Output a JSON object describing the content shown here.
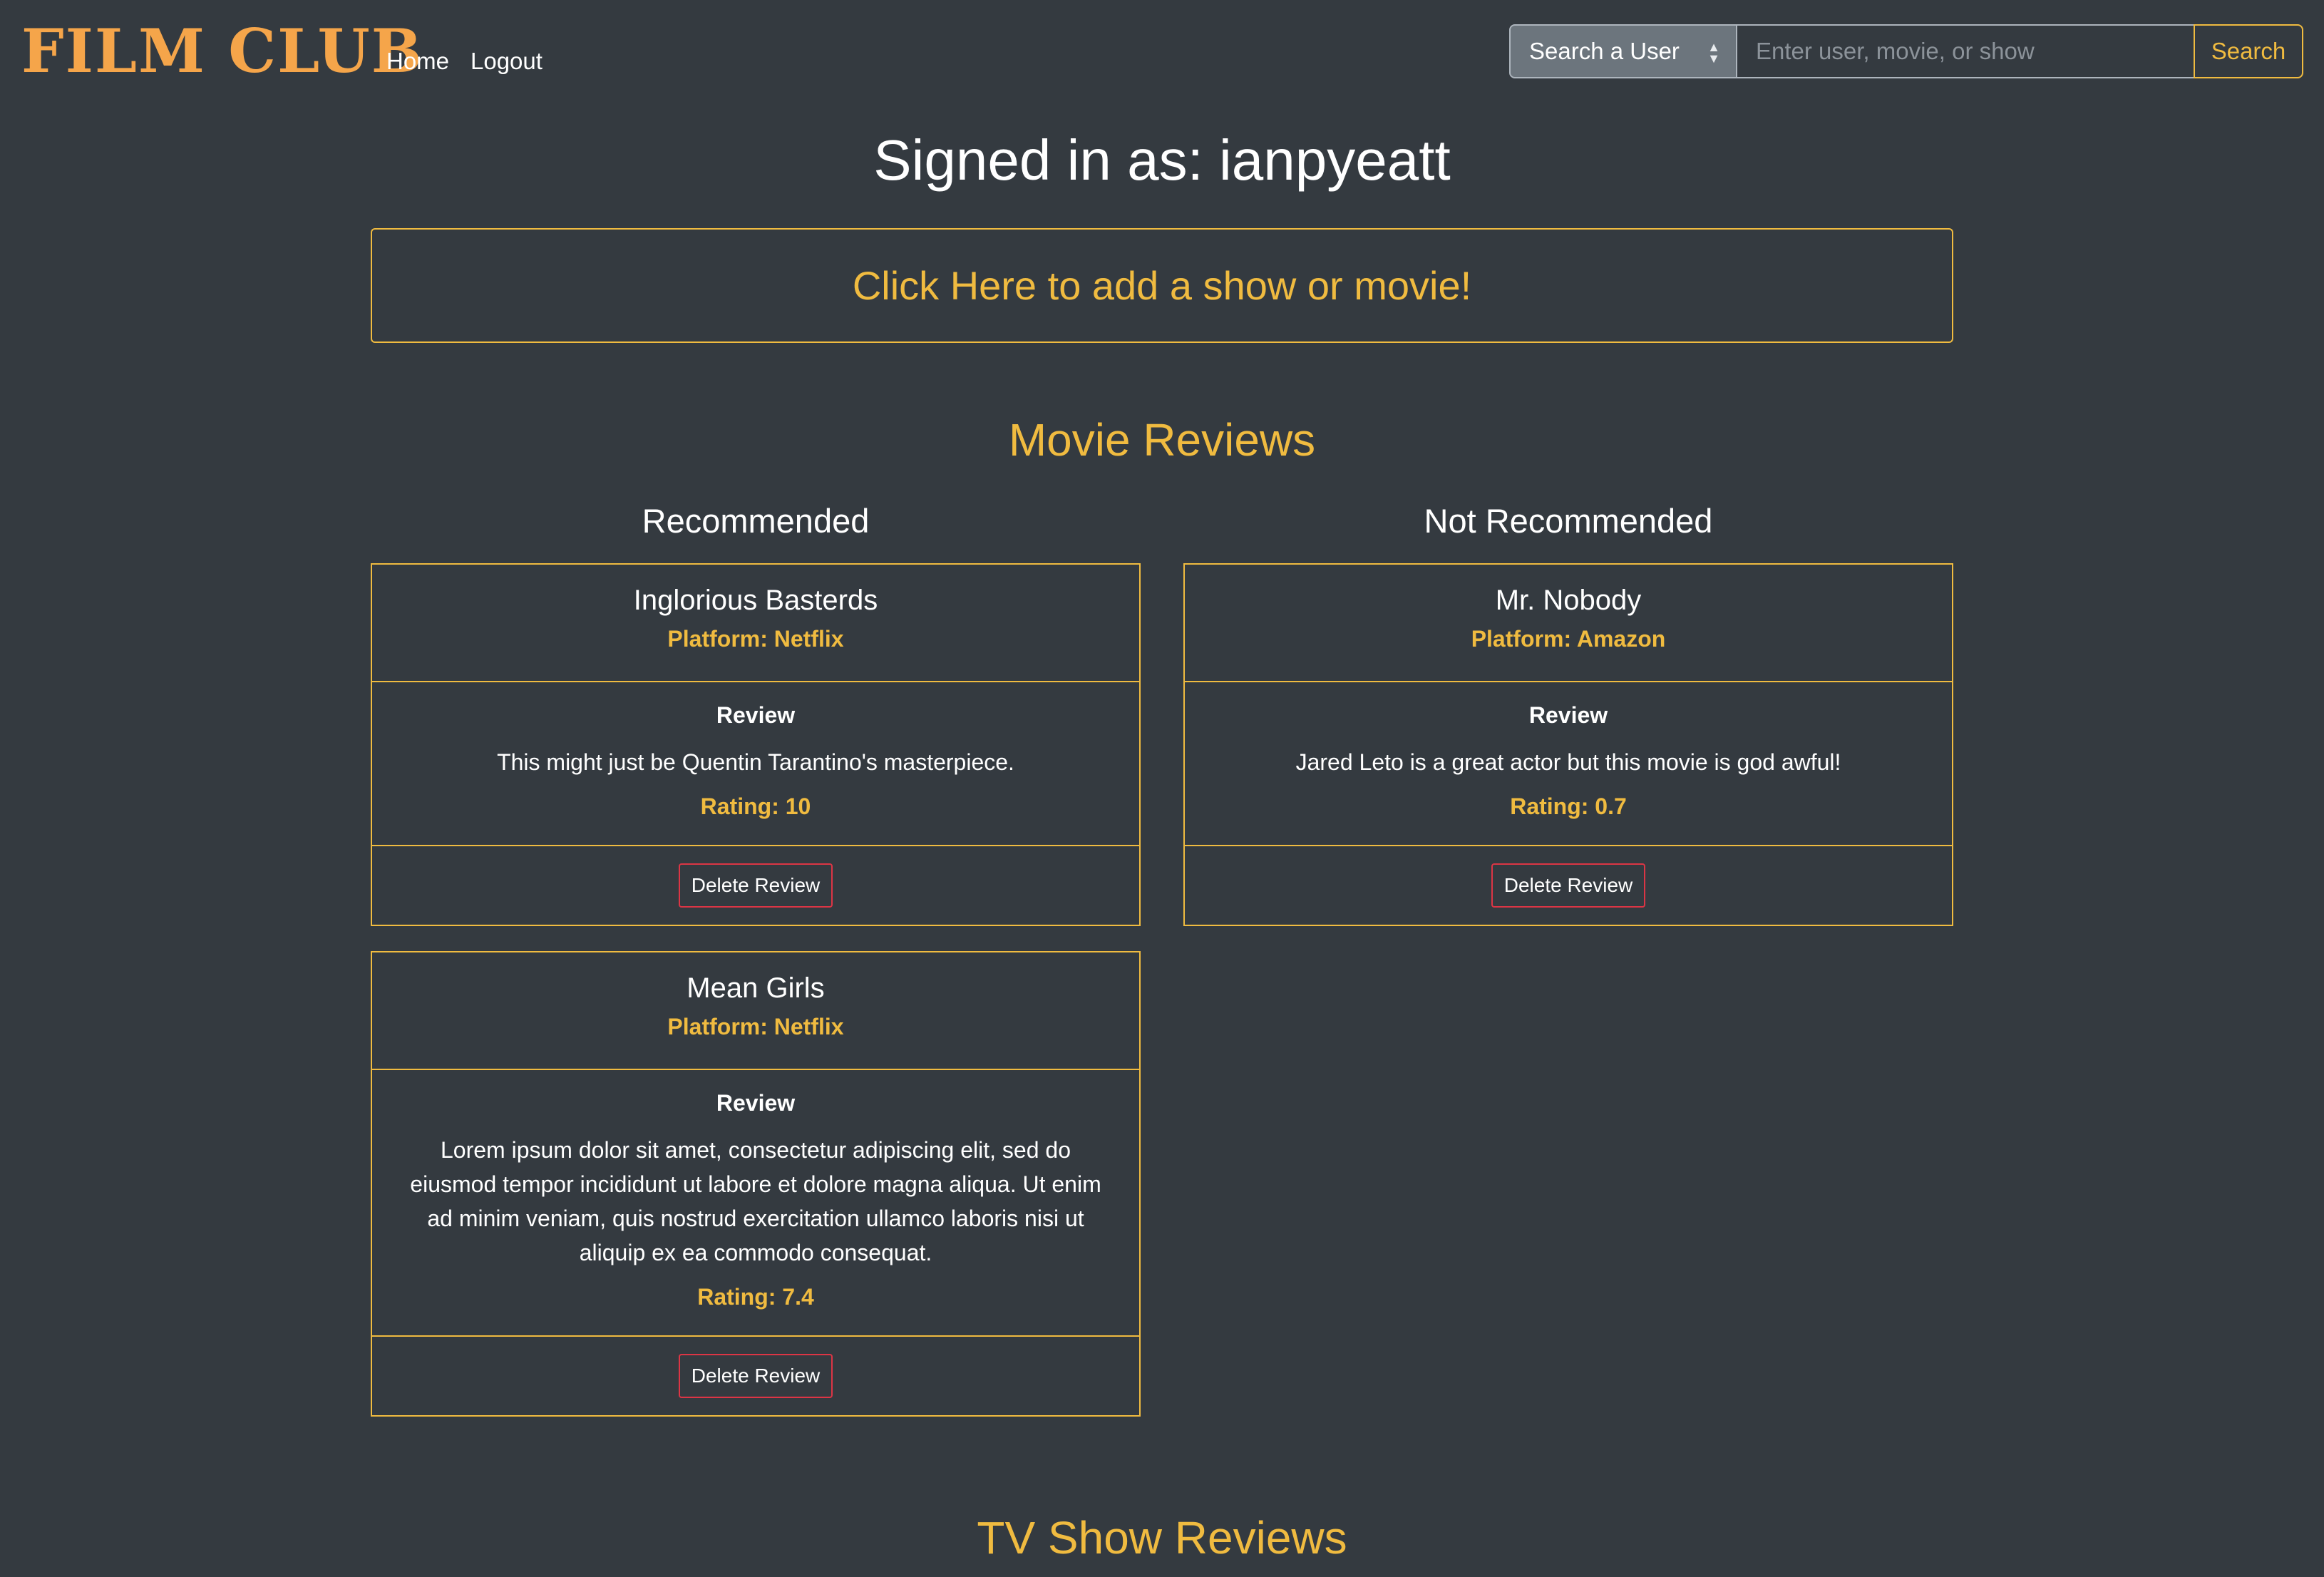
{
  "navbar": {
    "brand": "FILM CLUB",
    "links": {
      "home": "Home",
      "logout": "Logout"
    },
    "search": {
      "select_value": "Search a User",
      "input_placeholder": "Enter user, movie, or show",
      "button_label": "Search"
    }
  },
  "main": {
    "signed_in": "Signed in as: ianpyeatt",
    "add_prompt": "Click Here to add a show or movie!",
    "movie_section": {
      "title": "Movie Reviews",
      "recommended_heading": "Recommended",
      "not_recommended_heading": "Not Recommended",
      "cards": [
        {
          "title": "Inglorious Basterds",
          "platform": "Platform: Netflix",
          "review_label": "Review",
          "review_text": "This might just be Quentin Tarantino's masterpiece.",
          "rating": "Rating: 10",
          "delete_label": "Delete Review"
        },
        {
          "title": "Mr. Nobody",
          "platform": "Platform: Amazon",
          "review_label": "Review",
          "review_text": "Jared Leto is a great actor but this movie is god awful!",
          "rating": "Rating: 0.7",
          "delete_label": "Delete Review"
        },
        {
          "title": "Mean Girls",
          "platform": "Platform: Netflix",
          "review_label": "Review",
          "review_text": "Lorem ipsum dolor sit amet, consectetur adipiscing elit, sed do eiusmod tempor incididunt ut labore et dolore magna aliqua. Ut enim ad minim veniam, quis nostrud exercitation ullamco laboris nisi ut aliquip ex ea commodo consequat.",
          "rating": "Rating: 7.4",
          "delete_label": "Delete Review"
        }
      ]
    },
    "tv_section": {
      "title": "TV Show Reviews"
    }
  },
  "colors": {
    "background": "#343a40",
    "brand": "#f5a54a",
    "accent": "#f0bb40",
    "danger": "#dc3545"
  }
}
